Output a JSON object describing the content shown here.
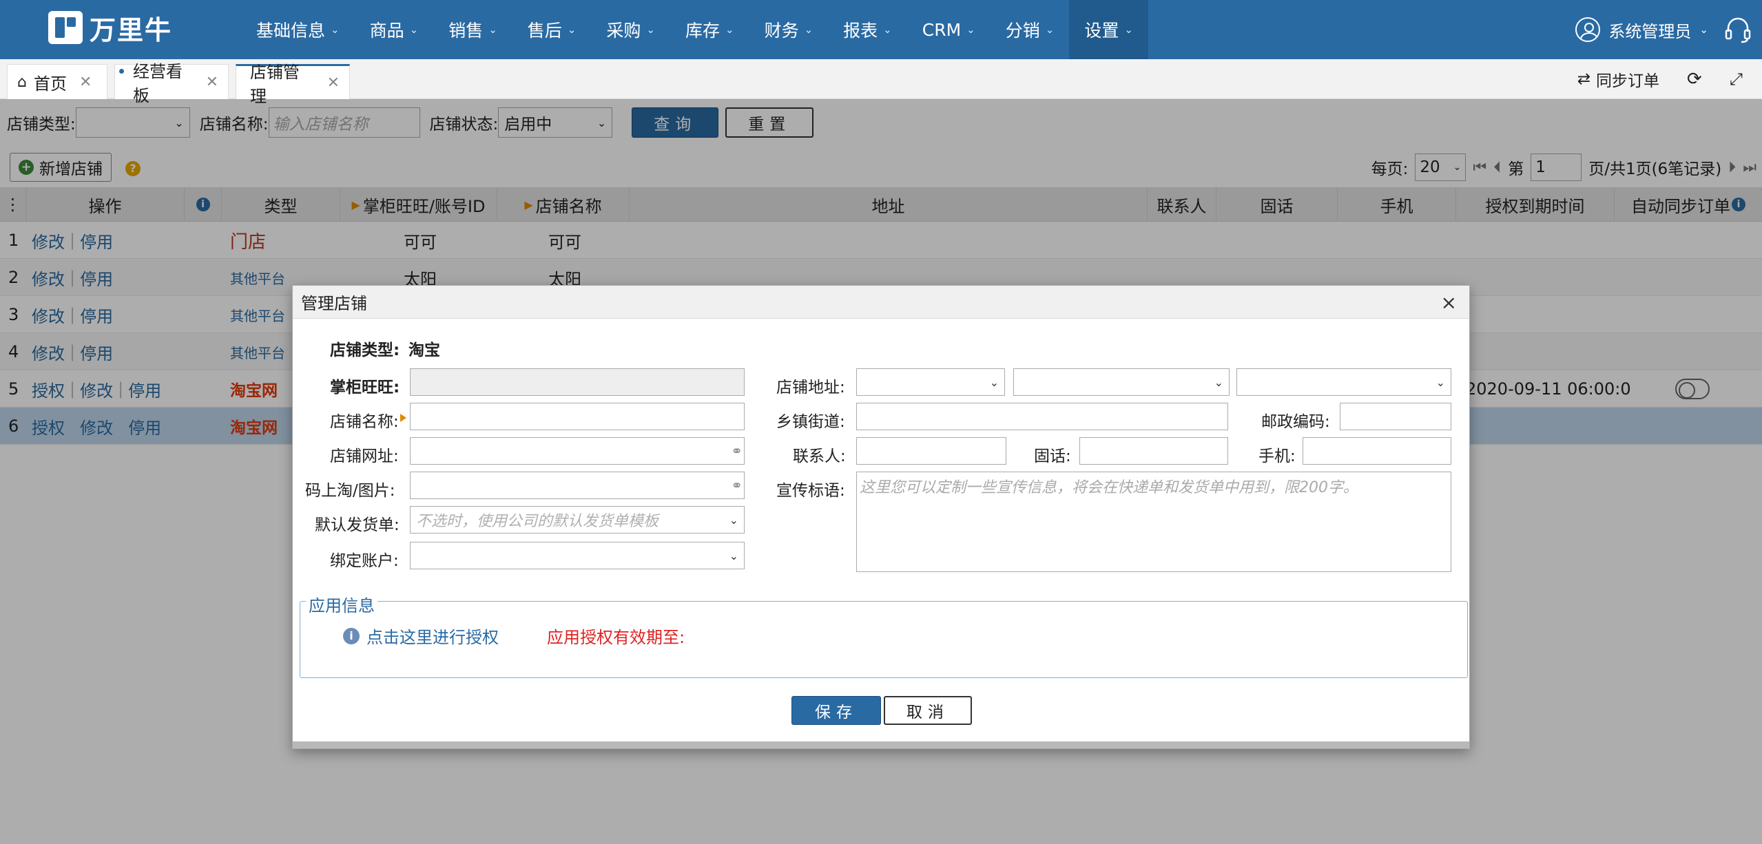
{
  "app": {
    "logo_text": "万里牛"
  },
  "nav": {
    "items": [
      {
        "label": "基础信息"
      },
      {
        "label": "商品"
      },
      {
        "label": "销售"
      },
      {
        "label": "售后"
      },
      {
        "label": "采购"
      },
      {
        "label": "库存"
      },
      {
        "label": "财务"
      },
      {
        "label": "报表"
      },
      {
        "label": "CRM"
      },
      {
        "label": "分销"
      },
      {
        "label": "设置"
      }
    ],
    "active": "设置",
    "user": "系统管理员"
  },
  "tabs": [
    {
      "label": "首页"
    },
    {
      "label": "经营看板"
    },
    {
      "label": "店铺管理"
    }
  ],
  "tab_actions": {
    "sync_orders": "同步订单"
  },
  "filter": {
    "store_type_label": "店铺类型:",
    "store_type_value": "",
    "store_name_label": "店铺名称:",
    "store_name_placeholder": "输入店铺名称",
    "store_status_label": "店铺状态:",
    "store_status_value": "启用中",
    "query": "查询",
    "reset": "重置"
  },
  "toolbar": {
    "add_store": "新增店铺"
  },
  "pager": {
    "per_page_label": "每页:",
    "per_page": "20",
    "page_prefix": "第",
    "page": "1",
    "page_suffix": "页/共1页(6笔记录)"
  },
  "table": {
    "headers": {
      "ops": "操作",
      "type": "类型",
      "account": "掌柜旺旺/账号ID",
      "name": "店铺名称",
      "address": "地址",
      "contact": "联系人",
      "phone": "固话",
      "mobile": "手机",
      "expiry": "授权到期时间",
      "auto_sync": "自动同步订单"
    },
    "rows": [
      {
        "num": "1",
        "type": "门店",
        "account": "可可",
        "name": "可可",
        "expiry": ""
      },
      {
        "num": "2",
        "type": "其他平台",
        "account": "太阳",
        "name": "太阳",
        "expiry": ""
      },
      {
        "num": "3",
        "type": "其他平台",
        "account": "",
        "name": "",
        "expiry": ""
      },
      {
        "num": "4",
        "type": "其他平台",
        "account": "",
        "name": "",
        "expiry": ""
      },
      {
        "num": "5",
        "type": "淘宝网",
        "account": "",
        "name": "",
        "expiry": "2020-09-11 06:00:0"
      },
      {
        "num": "6",
        "type": "淘宝网",
        "account": "",
        "name": "",
        "expiry": ""
      }
    ],
    "actions": {
      "auth": "授权",
      "edit": "修改",
      "disable": "停用"
    }
  },
  "dialog": {
    "title": "管理店铺",
    "store_type_label": "店铺类型:",
    "store_type_value": "淘宝",
    "wangwang_label": "掌柜旺旺:",
    "store_name_label": "店铺名称:",
    "store_url_label": "店铺网址:",
    "qr_label": "码上淘/图片:",
    "default_waybill_label": "默认发货单:",
    "default_waybill_placeholder": "不选时，使用公司的默认发货单模板",
    "bind_account_label": "绑定账户:",
    "address_label": "店铺地址:",
    "street_label": "乡镇街道:",
    "postcode_label": "邮政编码:",
    "contact_label": "联系人:",
    "phone_label": "固话:",
    "mobile_label": "手机:",
    "slogan_label": "宣传标语:",
    "slogan_placeholder": "这里您可以定制一些宣传信息，将会在快递单和发货单中用到，限200字。",
    "app_info_legend": "应用信息",
    "authorize_link": "点击这里进行授权",
    "auth_expiry": "应用授权有效期至:",
    "save": "保存",
    "cancel": "取消"
  },
  "colors": {
    "primary": "#2a6aa3",
    "warning": "#e02222",
    "taobao": "#e23a0c"
  }
}
